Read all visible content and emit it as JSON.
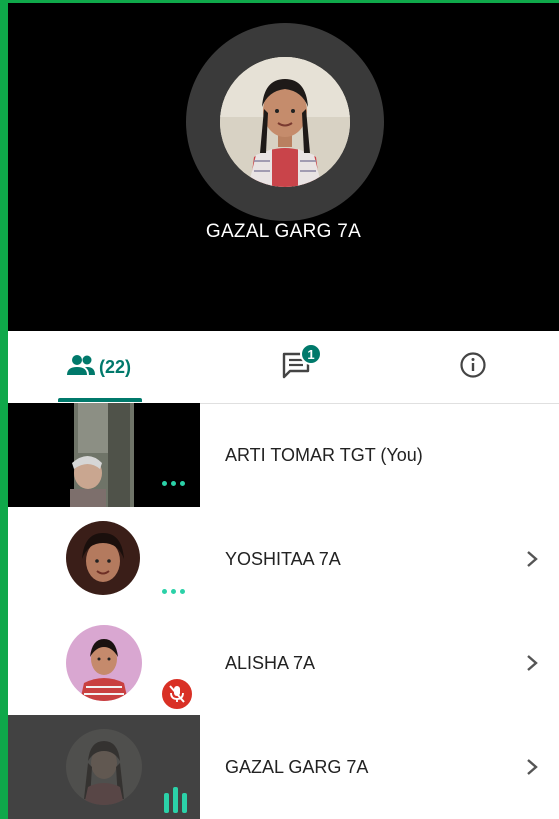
{
  "stage": {
    "speaker_name": "GAZAL GARG 7A"
  },
  "tabs": {
    "people_count": "(22)",
    "chat_badge": "1"
  },
  "participants": [
    {
      "name": "ARTI TOMAR TGT (You)",
      "status": "more-options"
    },
    {
      "name": "YOSHITAA 7A",
      "status": "more-options"
    },
    {
      "name": "ALISHA 7A",
      "status": "muted"
    },
    {
      "name": "GAZAL GARG 7A",
      "status": "speaking"
    }
  ],
  "colors": {
    "accent": "#00796b",
    "indicator": "#2bd1a8",
    "muted": "#d93025",
    "border": "#0fa84a"
  }
}
